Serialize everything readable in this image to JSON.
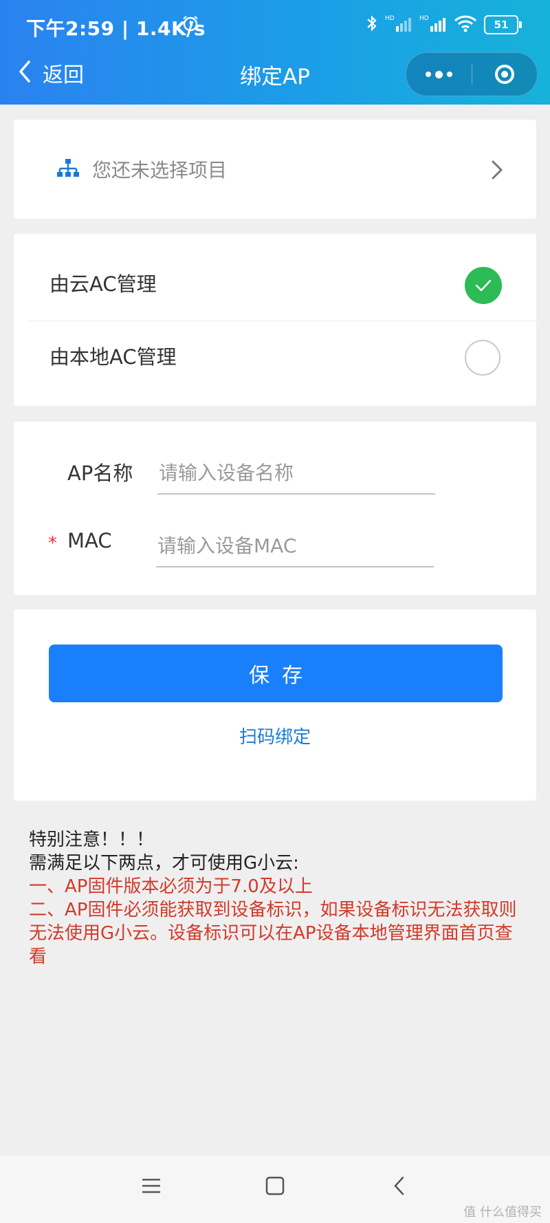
{
  "status_bar": {
    "time": "下午2:59 | 1.4K/s",
    "battery": "51"
  },
  "header": {
    "back_label": "返回",
    "title": "绑定AP"
  },
  "project": {
    "label": "您还未选择项目"
  },
  "management": {
    "options": [
      {
        "label": "由云AC管理",
        "selected": true
      },
      {
        "label": "由本地AC管理",
        "selected": false
      }
    ]
  },
  "form": {
    "name_label": "AP名称",
    "name_placeholder": "请输入设备名称",
    "mac_label": "MAC",
    "mac_required_mark": "*",
    "mac_placeholder": "请输入设备MAC"
  },
  "actions": {
    "save_label": "保存",
    "scan_label": "扫码绑定"
  },
  "notice": {
    "title": "特别注意！！！",
    "intro": "需满足以下两点，才可使用G小云:",
    "point1": "一、AP固件版本必须为于7.0及以上",
    "point2": "二、AP固件必须能获取到设备标识，如果设备标识无法获取则无法使用G小云。设备标识可以在AP设备本地管理界面首页查看"
  },
  "watermark": "值 什么值得买",
  "colors": {
    "accent": "#1a7ffb",
    "check": "#2cbb55",
    "warning": "#d23a2a"
  }
}
